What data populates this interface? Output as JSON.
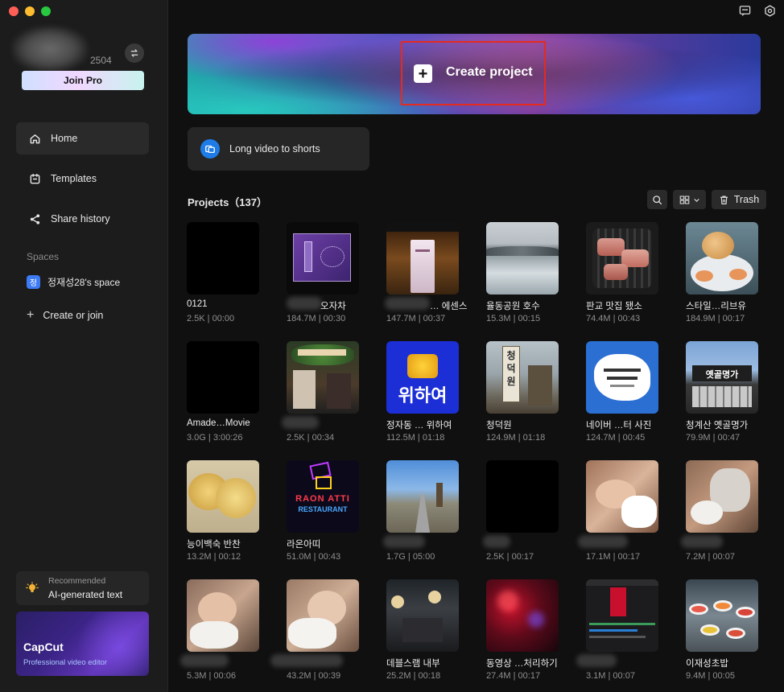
{
  "account": {
    "id_suffix": "2504",
    "join_pro": "Join Pro"
  },
  "nav": [
    {
      "label": "Home",
      "icon": "home-icon"
    },
    {
      "label": "Templates",
      "icon": "templates-icon"
    },
    {
      "label": "Share history",
      "icon": "share-icon"
    }
  ],
  "spaces": {
    "label": "Spaces",
    "item": "정재성28's space",
    "avatar": "정",
    "create": "Create or join"
  },
  "recommend": {
    "label": "Recommended",
    "title": "AI-generated text"
  },
  "promo": {
    "title": "CapCut",
    "subtitle": "Professional video editor"
  },
  "hero": {
    "label": "Create project"
  },
  "shorts": {
    "label": "Long video to shorts"
  },
  "projects": {
    "title": "Projects（137）",
    "trash": "Trash",
    "items": [
      {
        "name": "0121",
        "meta": "2.5K | 00:00"
      },
      {
        "name": "오자차",
        "meta": "184.7M | 00:30"
      },
      {
        "name": "… 에센스",
        "meta": "147.7M | 00:37"
      },
      {
        "name": "율동공원 호수",
        "meta": "15.3M | 00:15"
      },
      {
        "name": "판교 맛집 됐소",
        "meta": "74.4M | 00:43"
      },
      {
        "name": "스타일…리브유",
        "meta": "184.9M | 00:17"
      },
      {
        "name": "Amade…Movie",
        "meta": "3.0G | 3:00:26"
      },
      {
        "name": "",
        "meta": "2.5K | 00:34"
      },
      {
        "name": "정자동 … 위하여",
        "meta": "112.5M | 01:18"
      },
      {
        "name": "청덕원",
        "meta": "124.9M | 01:18"
      },
      {
        "name": "네이버 …터 사진",
        "meta": "124.7M | 00:45"
      },
      {
        "name": "청계산 옛골명가",
        "meta": "79.9M | 00:47"
      },
      {
        "name": "능이백숙 반찬",
        "meta": "13.2M | 00:12"
      },
      {
        "name": "라온아띠",
        "meta": "51.0M | 00:43"
      },
      {
        "name": "",
        "meta": "1.7G | 05:00"
      },
      {
        "name": "",
        "meta": "2.5K | 00:17"
      },
      {
        "name": "",
        "meta": "17.1M | 00:17"
      },
      {
        "name": "",
        "meta": "7.2M | 00:07"
      },
      {
        "name": "",
        "meta": "5.3M | 00:06"
      },
      {
        "name": "",
        "meta": "43.2M | 00:39"
      },
      {
        "name": "데블스램 내부",
        "meta": "25.2M | 00:18"
      },
      {
        "name": "동영상 …처리하기",
        "meta": "27.4M | 00:17"
      },
      {
        "name": "",
        "meta": "3.1M | 00:07"
      },
      {
        "name": "이재성초밥",
        "meta": "9.4M | 00:05"
      }
    ]
  },
  "thumb_texts": {
    "t9_line1": "위",
    "t9_line2": "하여",
    "t10": "청덕원",
    "t14_top": "RAON ATTI",
    "t14_bottom": "RESTAURANT",
    "t12": "옛골명가"
  },
  "colors": {
    "accent_blue": "#1e7ce8",
    "highlight_red": "#e52a1f"
  }
}
